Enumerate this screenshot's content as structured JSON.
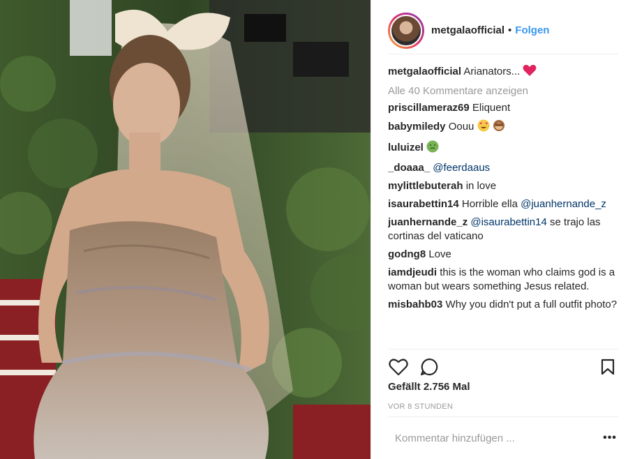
{
  "header": {
    "username": "metgalaofficial",
    "dot": "•",
    "follow_label": "Folgen"
  },
  "caption": {
    "username": "metgalaofficial",
    "text": "Arianators..."
  },
  "view_all_label": "Alle 40 Kommentare anzeigen",
  "comments": [
    {
      "user": "priscillameraz69",
      "text": "Eliquent"
    },
    {
      "user": "babymiledy",
      "text": "Oouu"
    },
    {
      "user": "luluizel",
      "text": ""
    },
    {
      "user": "_doaaa_",
      "mention": "@feerdaaus"
    },
    {
      "user": "mylittlebuterah",
      "text": "in love"
    },
    {
      "user": "isaurabettin14",
      "text": "Horrible ella",
      "mention": "@juanhernande_z"
    },
    {
      "user": "juanhernande_z",
      "mention": "@isaurabettin14",
      "text": "se trajo las cortinas del vaticano"
    },
    {
      "user": "godng8",
      "text": "Love"
    },
    {
      "user": "iamdjeudi",
      "text": "this is the woman who claims god is a woman but wears something Jesus related."
    },
    {
      "user": "misbahb03",
      "text": "Why you didn't put a full outfit photo?"
    }
  ],
  "likes_label": "Gefällt 2.756 Mal",
  "time_label": "VOR 8 STUNDEN",
  "comment_placeholder": "Kommentar hinzufügen ...",
  "more_label": "•••",
  "icons": {
    "like": "heart-icon",
    "comment": "speech-bubble-icon",
    "save": "bookmark-icon",
    "caption_emoji": "red-heart-emoji",
    "babymiledy_emojis": [
      "heart-eyes-emoji",
      "see-no-evil-monkey-emoji"
    ],
    "luluizel_emoji": "nauseated-face-emoji"
  },
  "colors": {
    "link_blue": "#3897f0",
    "mention_blue": "#003569",
    "muted": "#999999",
    "text": "#262626"
  }
}
